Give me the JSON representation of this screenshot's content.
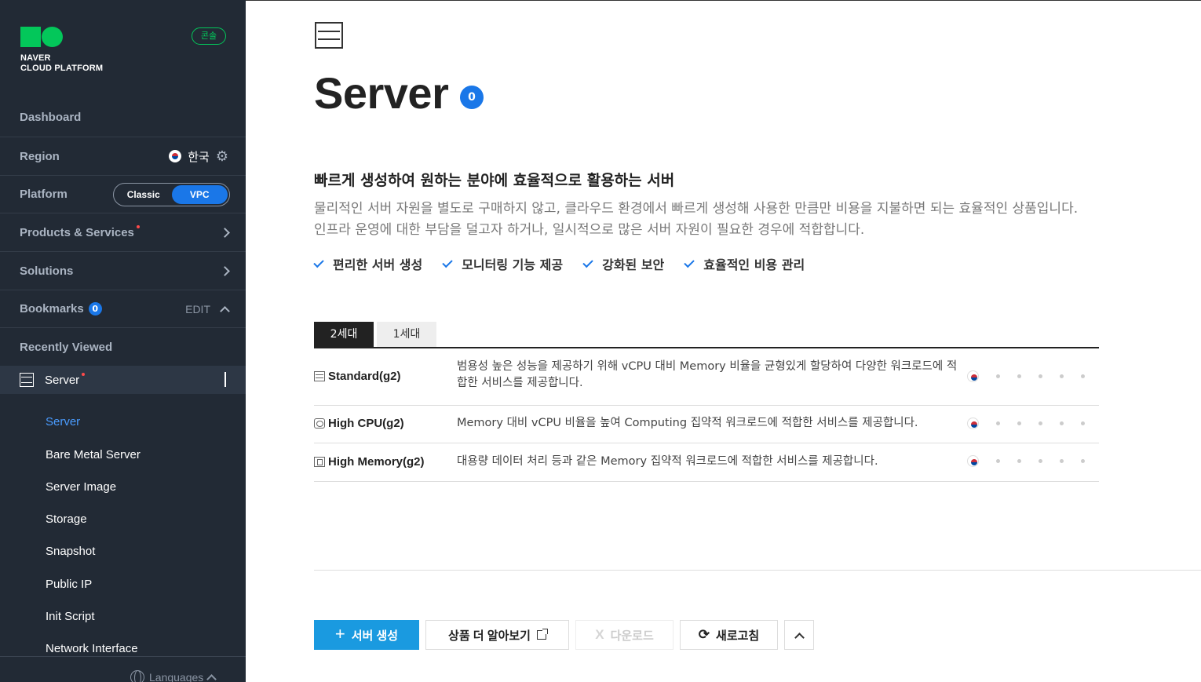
{
  "sidebar": {
    "logo_line1": "NAVER",
    "logo_line2": "CLOUD PLATFORM",
    "console_badge": "콘솔",
    "dashboard": "Dashboard",
    "region": {
      "label": "Region",
      "value": "한국"
    },
    "platform": {
      "label": "Platform",
      "options": [
        "Classic",
        "VPC"
      ],
      "selected": "VPC"
    },
    "products": "Products & Services",
    "solutions": "Solutions",
    "bookmarks": {
      "label": "Bookmarks",
      "count": "0",
      "edit": "EDIT"
    },
    "recently_viewed": "Recently Viewed",
    "server_group": "Server",
    "sub_items": [
      "Server",
      "Bare Metal Server",
      "Server Image",
      "Storage",
      "Snapshot",
      "Public IP",
      "Init Script",
      "Network Interface"
    ],
    "languages": "Languages"
  },
  "main": {
    "title": "Server",
    "count": "0",
    "headline": "빠르게 생성하여 원하는 분야에 효율적으로 활용하는 서버",
    "desc_line1": "물리적인 서버 자원을 별도로 구매하지 않고, 클라우드 환경에서 빠르게 생성해 사용한 만큼만 비용을 지불하면 되는 효율적인 상품입니다.",
    "desc_line2": "인프라 운영에 대한 부담을 덜고자 하거나, 일시적으로 많은 서버 자원이 필요한 경우에 적합합니다.",
    "features": [
      "편리한 서버 생성",
      "모니터링 기능 제공",
      "강화된 보안",
      "효율적인 비용 관리"
    ],
    "tabs": [
      "2세대",
      "1세대"
    ],
    "active_tab": "2세대",
    "server_types": [
      {
        "name": "Standard(g2)",
        "desc": "범용성 높은 성능을 제공하기 위해 vCPU 대비 Memory 비율을 균형있게 할당하여 다양한 워크로드에 적합한 서비스를 제공합니다."
      },
      {
        "name": "High CPU(g2)",
        "desc": "Memory 대비 vCPU 비율을 높여 Computing 집약적 워크로드에 적합한 서비스를 제공합니다."
      },
      {
        "name": "High Memory(g2)",
        "desc": "대용량 데이터 처리 등과 같은 Memory 집약적 워크로드에 적합한 서비스를 제공합니다."
      }
    ],
    "buttons": {
      "create": "서버 생성",
      "learn_more": "상품 더 알아보기",
      "download": "다운로드",
      "refresh": "새로고침"
    }
  },
  "colors": {
    "accent": "#1a77e8",
    "brand": "#03c75a",
    "sidebar_bg": "#222a35",
    "primary_button": "#1a9ae0"
  }
}
